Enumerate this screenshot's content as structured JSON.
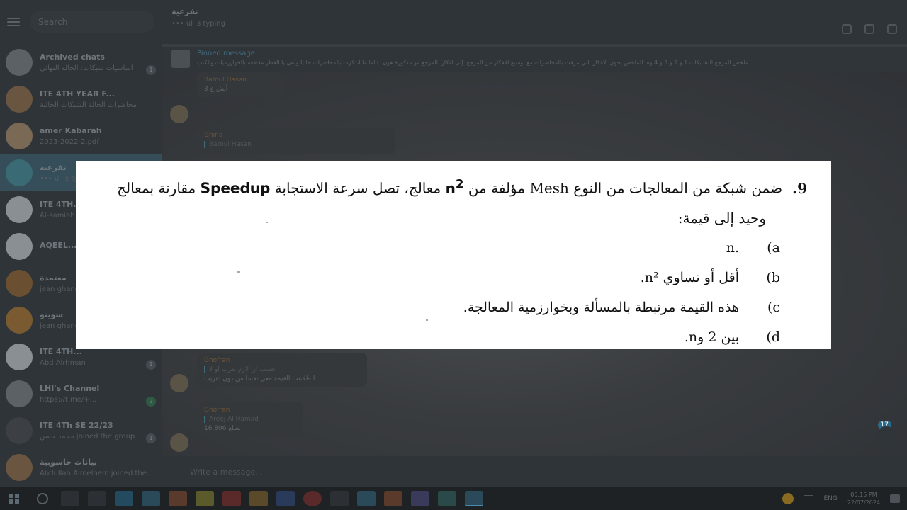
{
  "sidebar": {
    "search_placeholder": "Search",
    "chats": [
      {
        "name": "Archived chats",
        "last": "أساسيات شبكات: الحالة النهائي",
        "badge": "1",
        "avatar_color": "#5c6166"
      },
      {
        "name": "ITE 4TH YEAR F...",
        "last": "محاضرات الحالة الشبكات الحالية",
        "badge": "",
        "avatar_color": "#6a5540"
      },
      {
        "name": "amer Kabarah",
        "last": "2023-2022-2.pdf",
        "badge": "",
        "avatar_color": "#7a6a55"
      },
      {
        "name": "تفرعية",
        "last": "••• ul is typing",
        "badge": "",
        "avatar_color": "#3a6a73"
      },
      {
        "name": "ITE 4TH...",
        "last": "Al-samiah",
        "badge": "",
        "avatar_color": "#8a8f93"
      },
      {
        "name": "AQEEL...",
        "last": "",
        "badge": "",
        "avatar_color": "#8a8f93"
      },
      {
        "name": "معتمدة",
        "last": "jean ghanem",
        "badge": "",
        "avatar_color": "#6a5030"
      },
      {
        "name": "سويتو",
        "last": "jean ghanem",
        "badge": "",
        "avatar_color": "#7a5a30"
      },
      {
        "name": "ITE 4TH...",
        "last": "Abd Alrhman",
        "badge": "1",
        "avatar_color": "#8a8f93"
      },
      {
        "name": "LHI's Channel",
        "last": "https://t.me/+...",
        "badge": "2",
        "avatar_color": "#5c6166"
      },
      {
        "name": "ITE 4Th SE 22/23",
        "last": "محمد حسن joined the group",
        "badge": "1",
        "avatar_color": "#3c4044"
      },
      {
        "name": "بيانات حاسوبية",
        "last": "Abdullah Almelhem joined the...",
        "badge": "",
        "avatar_color": "#6a5540"
      }
    ]
  },
  "header": {
    "title": "تفرعية",
    "status": "••• ul is typing"
  },
  "pinned": {
    "label": "Pinned message",
    "text": "ملخص المرجع التشابكات 1 و 2 و 3 و 4 وه. الملخص يحوي الأفكار التي مرقت بالمحاضرات مع توسيع الأفكار من المرجع، إلى أفكار بالمرجع مو مذكورة هون :) أما ما انذكرت بالمحاضرات حالياً و هي يا الفطر مقطعة بالخوارزميات والكتب..."
  },
  "messages": [
    {
      "name": "Batoul Hasan",
      "quote": "",
      "text": "3 أيش ع"
    },
    {
      "name": "Ghina",
      "quote": "Batoul Hasan",
      "text": ""
    },
    {
      "name": "Ghofran",
      "quote": "حسب ازا لازم تقرب او لا",
      "text": "الطلاعت القيمة معي نفسا من دون تقريب"
    },
    {
      "name": "Ghofran",
      "quote": "Areej Al Hamad",
      "text": "بطلع 16.806"
    }
  ],
  "composer": {
    "placeholder": "Write a message..."
  },
  "unread_count": "17",
  "question": {
    "number": "9.",
    "stem_1a": "ضمن شبكة من المعالجات من النوع",
    "mesh": "Mesh",
    "stem_1b": "مؤلفة من",
    "n2_stem": "n",
    "sup2": "2",
    "stem_1c": "معالج، تصل سرعة الاستجابة",
    "speedup": "Speedup",
    "stem_1d": "مقارنة بمعالج",
    "stem_2": "وحيد إلى قيمة:",
    "options": [
      {
        "letter": "(a",
        "text": ".n"
      },
      {
        "letter": "(b",
        "text": "أقل أو تساوي n²."
      },
      {
        "letter": "(c",
        "text": "هذه القيمة مرتبطة بالمسألة وبخوارزمية المعالجة."
      },
      {
        "letter": "(d",
        "text": "بين 2 وn."
      }
    ]
  },
  "taskbar": {
    "lang": "ENG",
    "time": "05:15 PM",
    "date": "22/07/2024"
  }
}
